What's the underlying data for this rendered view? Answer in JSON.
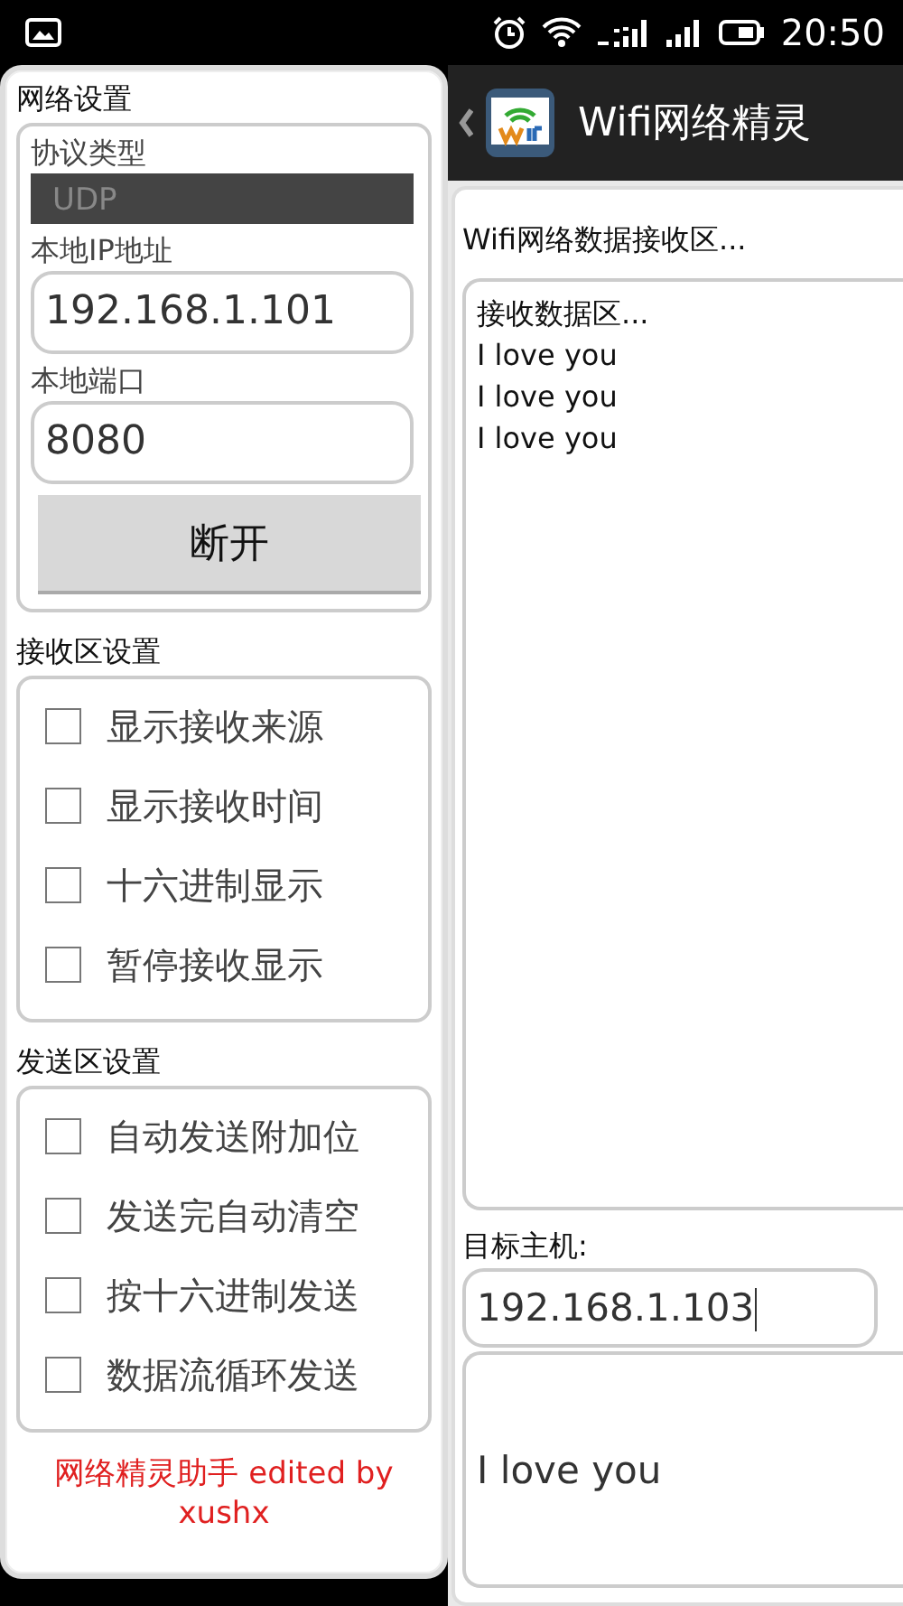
{
  "status_bar": {
    "time": "20:50"
  },
  "app_bar": {
    "title": "Wifi网络精灵"
  },
  "drawer": {
    "network_settings": {
      "title": "网络设置",
      "protocol_label": "协议类型",
      "protocol": "UDP",
      "ip_label": "本地IP地址",
      "ip": "192.168.1.101",
      "port_label": "本地端口",
      "port": "8080",
      "button": "断开"
    },
    "receive_settings": {
      "title": "接收区设置",
      "options": [
        {
          "label": "显示接收来源",
          "checked": false
        },
        {
          "label": "显示接收时间",
          "checked": false
        },
        {
          "label": "十六进制显示",
          "checked": false
        },
        {
          "label": "暂停接收显示",
          "checked": false
        }
      ]
    },
    "send_settings": {
      "title": "发送区设置",
      "options": [
        {
          "label": "自动发送附加位",
          "checked": false
        },
        {
          "label": "发送完自动清空",
          "checked": false
        },
        {
          "label": "按十六进制发送",
          "checked": false
        },
        {
          "label": "数据流循环发送",
          "checked": false
        }
      ]
    },
    "footer": "网络精灵助手  edited by xushx"
  },
  "main": {
    "receive_title": "Wifi网络数据接收区...",
    "receive_lines": [
      "接收数据区...",
      "I love you",
      "I love you",
      "I love you"
    ],
    "target_label": "目标主机:",
    "target": "192.168.1.103",
    "send_text": "I love you"
  }
}
